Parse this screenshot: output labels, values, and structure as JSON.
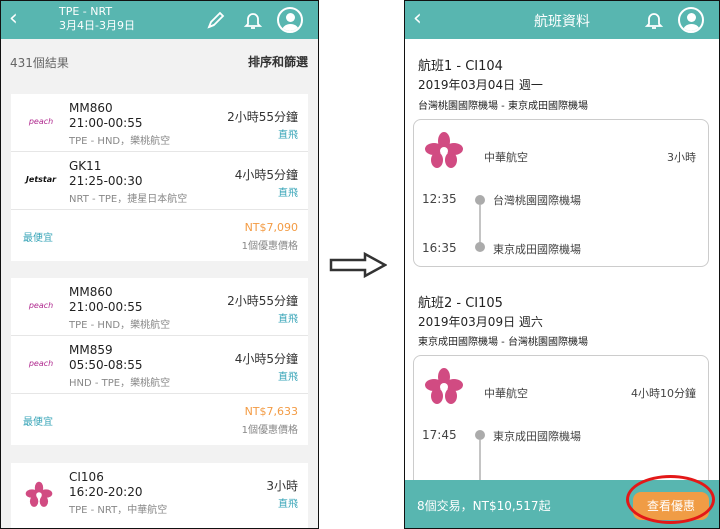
{
  "left": {
    "header": {
      "route": "TPE - NRT",
      "dates": "3月4日-3月9日",
      "pencil_icon": "pencil-icon",
      "bell_icon": "bell-icon",
      "avatar_icon": "user-avatar-icon"
    },
    "results_count": "431個結果",
    "sort_label": "排序和篩選",
    "cards": [
      {
        "flights": [
          {
            "airline_logo": "peach",
            "flight_no": "MM860",
            "time": "21:00-00:55",
            "route": "TPE - HND，樂桃航空",
            "duration": "2小時55分鐘",
            "tag": "直飛"
          },
          {
            "airline_logo": "Jetstar",
            "flight_no": "GK11",
            "time": "21:25-00:30",
            "route": "NRT - TPE，捷星日本航空",
            "duration": "4小時5分鐘",
            "tag": "直飛"
          }
        ],
        "label": "最便宜",
        "price": "NT$7,090",
        "offers": "1個優惠價格"
      },
      {
        "flights": [
          {
            "airline_logo": "peach",
            "flight_no": "MM860",
            "time": "21:00-00:55",
            "route": "TPE - HND，樂桃航空",
            "duration": "2小時55分鐘",
            "tag": "直飛"
          },
          {
            "airline_logo": "peach",
            "flight_no": "MM859",
            "time": "05:50-08:55",
            "route": "HND - TPE，樂桃航空",
            "duration": "4小時5分鐘",
            "tag": "直飛"
          }
        ],
        "label": "最便宜",
        "price": "NT$7,633",
        "offers": "1個優惠價格"
      },
      {
        "flights": [
          {
            "airline_logo": "china-airlines-blossom",
            "flight_no": "CI106",
            "time": "16:20-20:20",
            "route": "TPE - NRT，中華航空",
            "duration": "3小時",
            "tag": "直飛"
          }
        ]
      }
    ]
  },
  "right": {
    "header": {
      "title": "航班資料",
      "bell_icon": "bell-icon",
      "avatar_icon": "user-avatar-icon"
    },
    "flights": [
      {
        "title": "航班1 - CI104",
        "date": "2019年03月04日 週一",
        "airports": "台灣桃園國際機場 - 東京成田國際機場",
        "airline": "中華航空",
        "duration": "3小時",
        "dep_time": "12:35",
        "dep_airport": "台灣桃園國際機場",
        "arr_time": "16:35",
        "arr_airport": "東京成田國際機場"
      },
      {
        "title": "航班2 - CI105",
        "date": "2019年03月09日 週六",
        "airports": "東京成田國際機場 - 台灣桃園國際機場",
        "airline": "中華航空",
        "duration": "4小時10分鐘",
        "dep_time": "17:45",
        "dep_airport": "東京成田國際機場"
      }
    ],
    "footer": {
      "summary": "8個交易，NT$10,517起",
      "button": "查看優惠"
    }
  },
  "colors": {
    "teal": "#58b6b0",
    "accent_blue": "#39a5b8",
    "orange": "#f39b44",
    "red_ring": "#e31818"
  }
}
